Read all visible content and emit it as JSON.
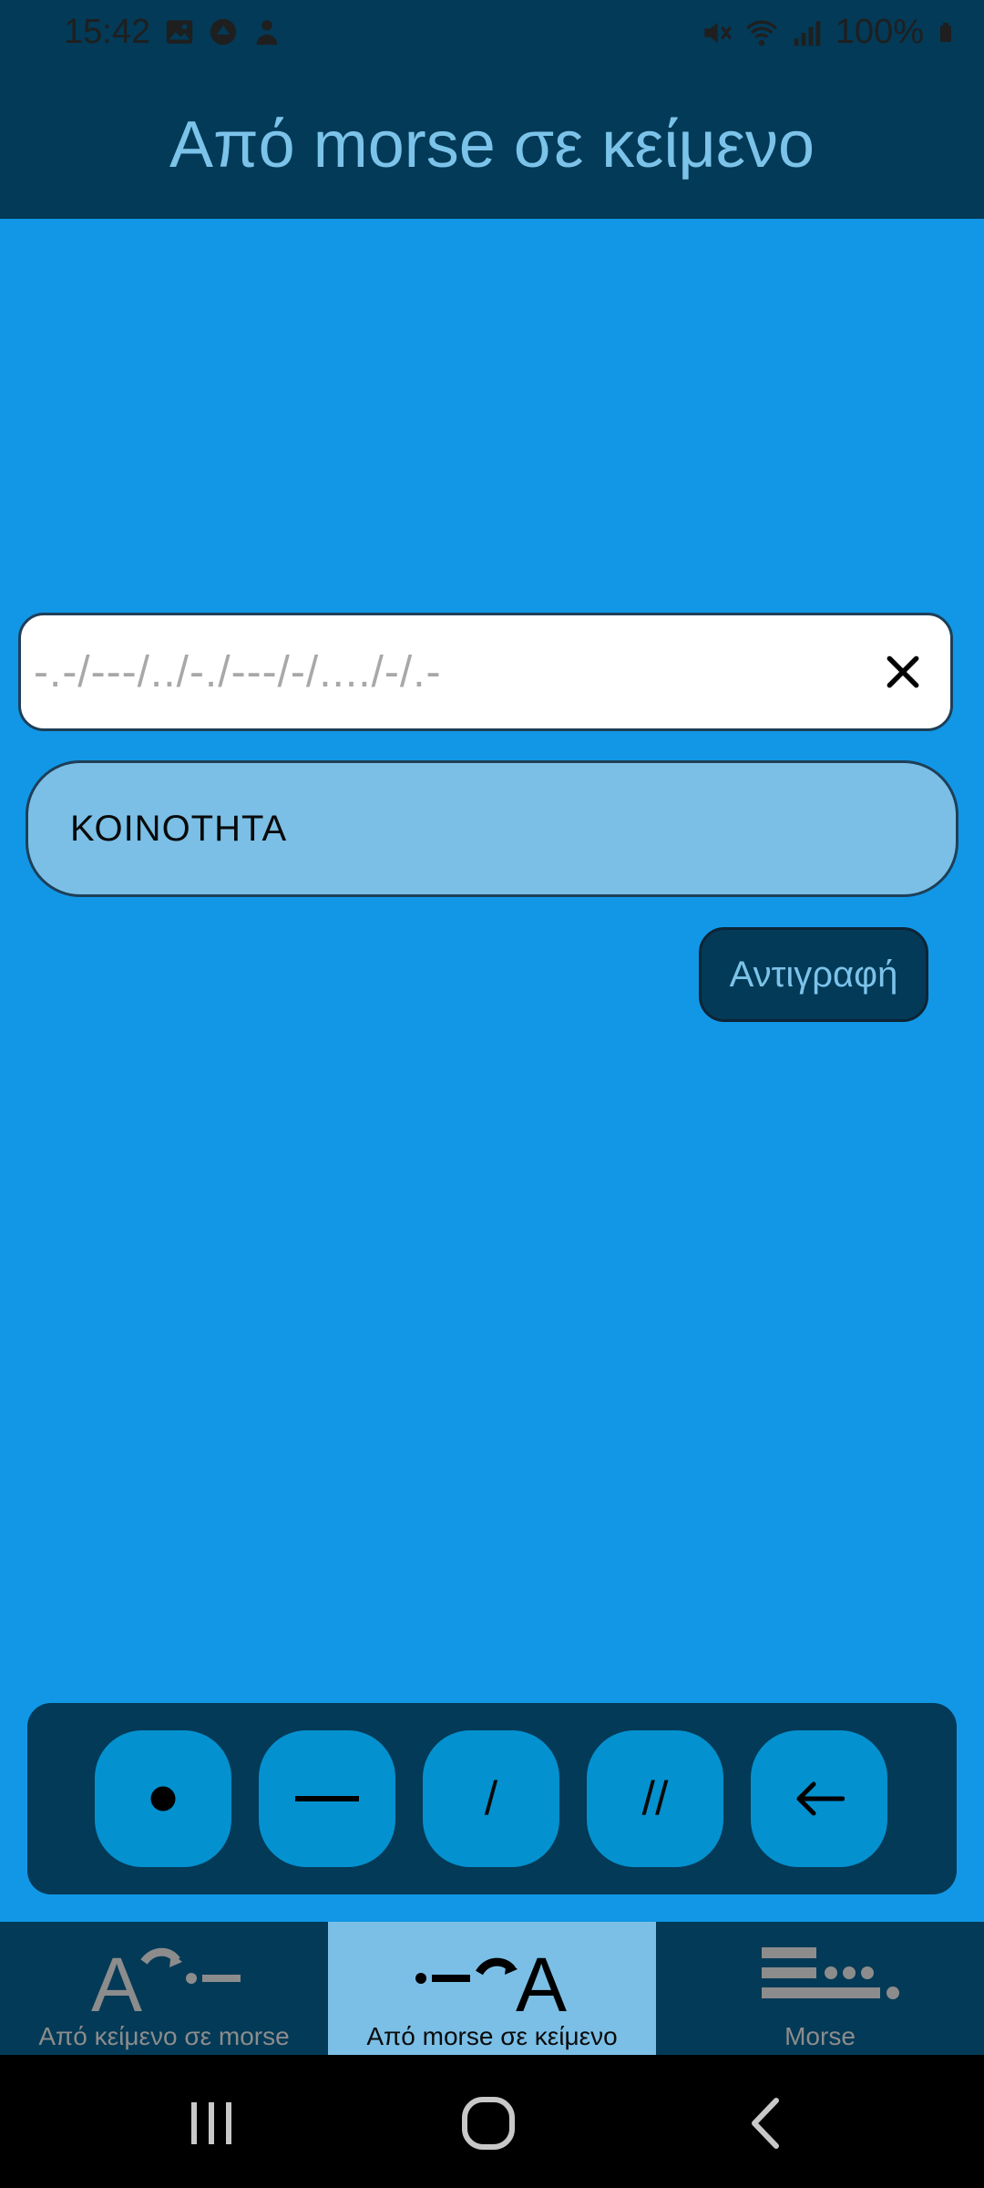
{
  "status_bar": {
    "time": "15:42",
    "battery": "100%",
    "icons": [
      "image-icon",
      "circle-icon",
      "person-icon",
      "mute-icon",
      "wifi-icon",
      "signal-icon",
      "battery-icon"
    ]
  },
  "app_bar": {
    "title": "Από morse σε κείμενο"
  },
  "input": {
    "placeholder": "-.-/---/../-./---/-/..../-/.-",
    "value": ""
  },
  "output": {
    "text": "ΚΟΙΝΟΤΗΤΑ"
  },
  "copy_button": {
    "label": "Αντιγραφή"
  },
  "keypad": {
    "keys": [
      {
        "name": "dot",
        "label": "•"
      },
      {
        "name": "dash",
        "label": "—"
      },
      {
        "name": "slash",
        "label": "/"
      },
      {
        "name": "double-slash",
        "label": "//"
      },
      {
        "name": "backspace",
        "label": "←"
      }
    ]
  },
  "bottom_nav": {
    "items": [
      {
        "label": "Από κείμενο σε morse",
        "icon": "text-to-morse-icon",
        "active": false
      },
      {
        "label": "Από morse σε κείμενο",
        "icon": "morse-to-text-icon",
        "active": true
      },
      {
        "label": "Morse",
        "icon": "morse-table-icon",
        "active": false
      }
    ]
  },
  "colors": {
    "background": "#1197e6",
    "app_bar": "#033a57",
    "accent_text": "#7cc3ea",
    "output_bg": "#7bbfe6",
    "key_bg": "#0491cf"
  }
}
